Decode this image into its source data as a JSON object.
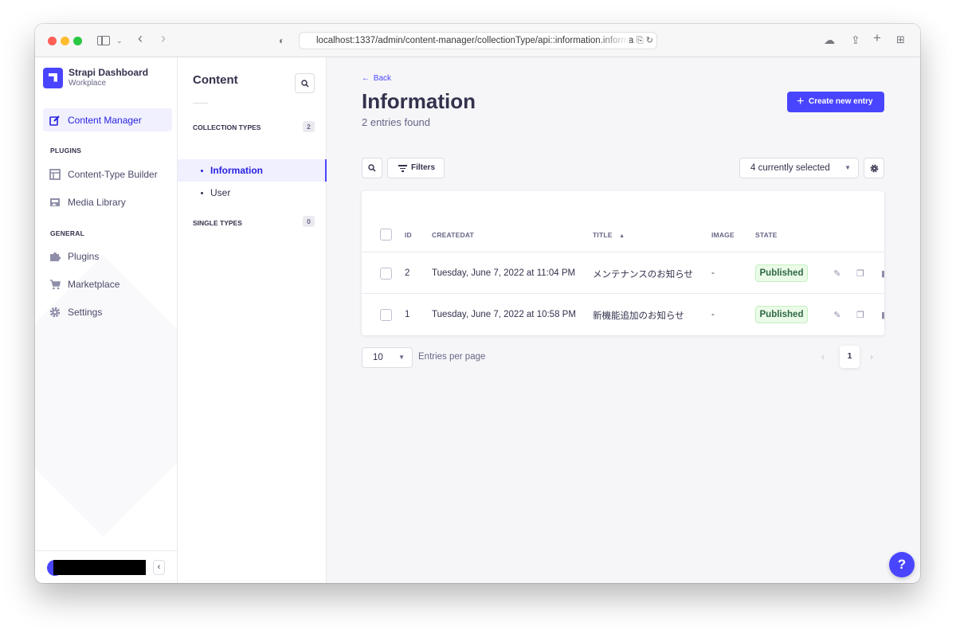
{
  "browser": {
    "url": "localhost:1337/admin/content-manager/collectionType/api::information.informa"
  },
  "brand": {
    "title": "Strapi Dashboard",
    "subtitle": "Workplace"
  },
  "mainnav": {
    "content_manager": "Content Manager",
    "plugins_section": "PLUGINS",
    "plugins_items": [
      "Content-Type Builder",
      "Media Library"
    ],
    "general_section": "GENERAL",
    "general_items": [
      "Plugins",
      "Marketplace",
      "Settings"
    ]
  },
  "subnav": {
    "title": "Content",
    "collection_types_label": "COLLECTION TYPES",
    "collection_types_count": "2",
    "collection_items": [
      "Information",
      "User"
    ],
    "single_types_label": "SINGLE TYPES",
    "single_types_count": "0"
  },
  "content": {
    "back": "Back",
    "title": "Information",
    "entries_found": "2 entries found",
    "create_button": "Create new entry",
    "filters_button": "Filters",
    "columns_select": "4 currently selected"
  },
  "table": {
    "headers": {
      "id": "ID",
      "createdat": "CREATEDAT",
      "title": "TITLE",
      "image": "IMAGE",
      "state": "STATE"
    },
    "rows": [
      {
        "id": "2",
        "createdat": "Tuesday, June 7, 2022 at 11:04 PM",
        "title": "メンテナンスのお知らせ",
        "image": "-",
        "state": "Published"
      },
      {
        "id": "1",
        "createdat": "Tuesday, June 7, 2022 at 10:58 PM",
        "title": "新機能追加のお知らせ",
        "image": "-",
        "state": "Published"
      }
    ]
  },
  "pagination": {
    "per_page": "10",
    "per_page_label": "Entries per page",
    "current_page": "1"
  },
  "help": "?",
  "colors": {
    "accent": "#4945ff",
    "published_bg": "#eafbe7",
    "published_text": "#2f6846"
  }
}
